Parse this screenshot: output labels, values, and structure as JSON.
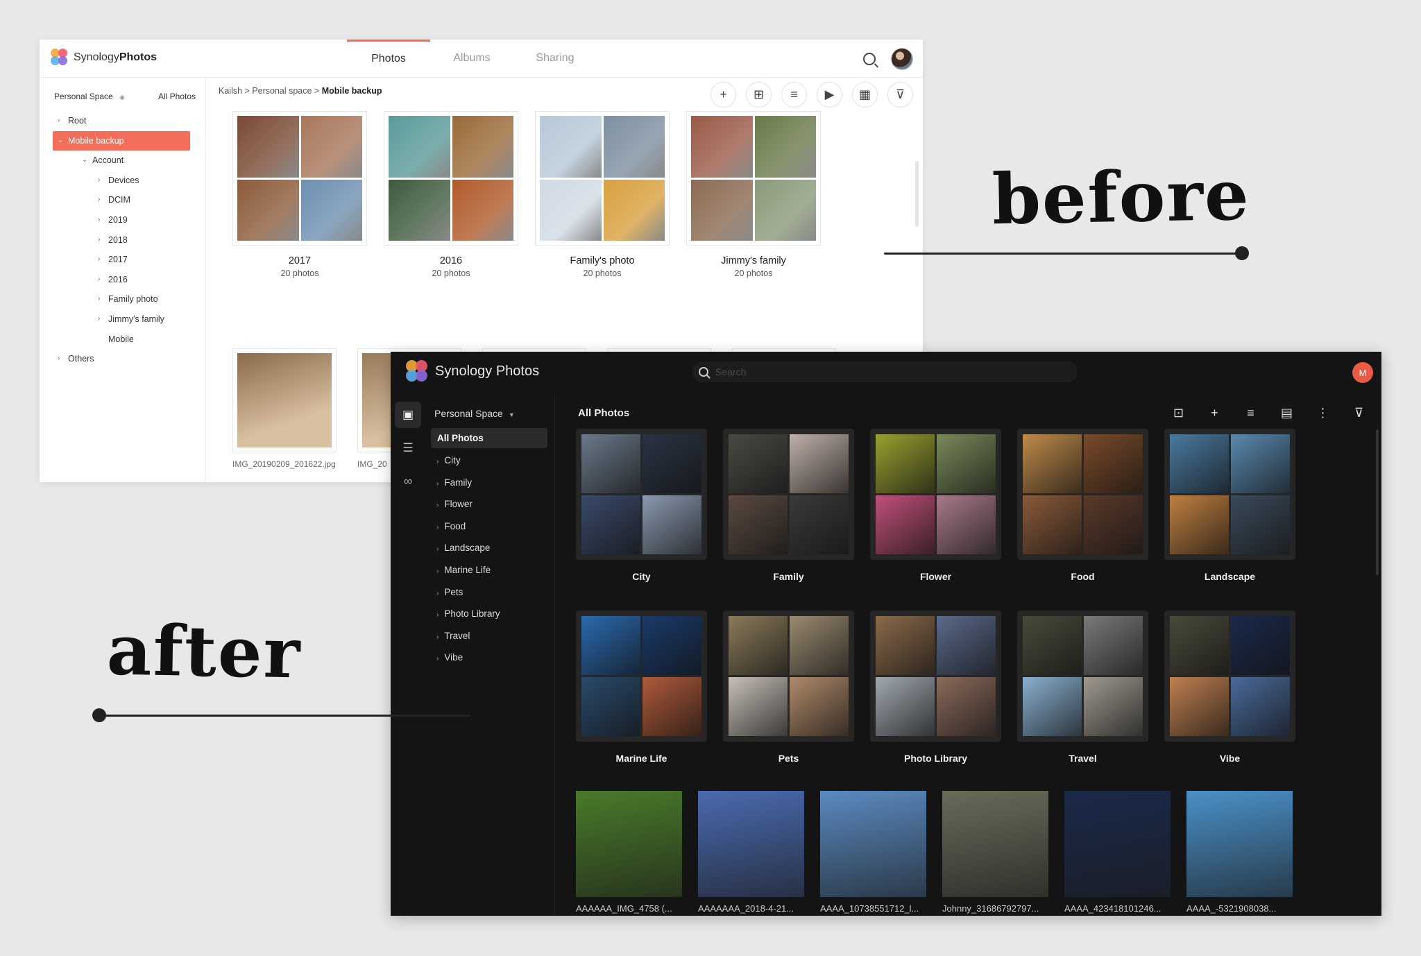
{
  "annotations": {
    "before": "before",
    "after": "after"
  },
  "colors": {
    "accent": "#f36e5a",
    "dark_bg": "#141414",
    "avatar": "#e85b47"
  },
  "light": {
    "brand_prefix": "Synology",
    "brand_suffix": "Photos",
    "tabs": [
      "Photos",
      "Albums",
      "Sharing"
    ],
    "active_tab": "Photos",
    "sidebar": {
      "space": "Personal Space",
      "all_photos": "All Photos",
      "tree": [
        {
          "label": "Root",
          "depth": 0,
          "icon": "chevron-right"
        },
        {
          "label": "Mobile backup",
          "depth": 0,
          "icon": "chevron-down",
          "selected": true
        },
        {
          "label": "Account",
          "depth": 1,
          "icon": "chevron-down"
        },
        {
          "label": "Devices",
          "depth": 2,
          "icon": "chevron-right"
        },
        {
          "label": "DCIM",
          "depth": 2,
          "icon": "chevron-right"
        },
        {
          "label": "2019",
          "depth": 2,
          "icon": "chevron-right"
        },
        {
          "label": "2018",
          "depth": 2,
          "icon": "chevron-right"
        },
        {
          "label": "2017",
          "depth": 2,
          "icon": "chevron-right"
        },
        {
          "label": "2016",
          "depth": 2,
          "icon": "chevron-right"
        },
        {
          "label": "Family photo",
          "depth": 2,
          "icon": "chevron-right"
        },
        {
          "label": "Jimmy's family",
          "depth": 2,
          "icon": "chevron-right"
        },
        {
          "label": "Mobile",
          "depth": 2,
          "icon": ""
        },
        {
          "label": "Others",
          "depth": 0,
          "icon": "chevron-right"
        }
      ]
    },
    "breadcrumb": {
      "path": "Kailsh > Personal space > ",
      "current": "Mobile backup"
    },
    "albums": [
      {
        "title": "2017",
        "count": "20 photos",
        "colors": [
          "#7a4a35",
          "#a8765a",
          "#8c5b3a",
          "#6d8fb0"
        ]
      },
      {
        "title": "2016",
        "count": "20 photos",
        "colors": [
          "#5b9a9a",
          "#9a6a3a",
          "#3e5a3e",
          "#b05a2a"
        ]
      },
      {
        "title": "Family's photo",
        "count": "20 photos",
        "colors": [
          "#b8c8d8",
          "#7d8fa0",
          "#d0dae4",
          "#d8a040"
        ]
      },
      {
        "title": "Jimmy's family",
        "count": "20 photos",
        "colors": [
          "#9a5a48",
          "#6a7a4a",
          "#8a6a52",
          "#8a9a7a"
        ]
      }
    ],
    "photos": [
      {
        "name": "IMG_20190209_201622.jpg",
        "color": "#8a6a4a"
      },
      {
        "name": "IMG_20",
        "color": "#9a7a5a"
      },
      {
        "name": "",
        "color": "#a88060"
      },
      {
        "name": "",
        "color": "#9a5a3a"
      },
      {
        "name": "",
        "color": "#a87a60"
      }
    ]
  },
  "dark": {
    "brand": "Synology Photos",
    "search_placeholder": "Search",
    "avatar_initial": "M",
    "space": "Personal Space",
    "tree": [
      "All Photos",
      "City",
      "Family",
      "Flower",
      "Food",
      "Landscape",
      "Marine Life",
      "Pets",
      "Photo Library",
      "Travel",
      "Vibe"
    ],
    "heading": "All Photos",
    "albums": [
      {
        "title": "City",
        "colors": [
          "#6a7a8a",
          "#2a3444",
          "#3a4a6a",
          "#8a9ab0"
        ]
      },
      {
        "title": "Family",
        "colors": [
          "#4a4a44",
          "#c0b0a8",
          "#5a4a40",
          "#3a3a3a"
        ]
      },
      {
        "title": "Flower",
        "colors": [
          "#9aa030",
          "#7a8a5a",
          "#c0507a",
          "#a87a8a"
        ]
      },
      {
        "title": "Food",
        "colors": [
          "#c08a4a",
          "#7a4a2a",
          "#8a5a3a",
          "#5a3a2a"
        ]
      },
      {
        "title": "Landscape",
        "colors": [
          "#4a7aa0",
          "#5a8ab0",
          "#c08040",
          "#3a4a5a"
        ]
      },
      {
        "title": "Marine Life",
        "colors": [
          "#2a6ab0",
          "#1a3a6a",
          "#2a4a6a",
          "#b05a3a"
        ]
      },
      {
        "title": "Pets",
        "colors": [
          "#8a7a5a",
          "#9a8a70",
          "#c8c0b8",
          "#b08a6a"
        ]
      },
      {
        "title": "Photo Library",
        "colors": [
          "#8a6a4a",
          "#5a6a8a",
          "#a0a8b0",
          "#8a6a5a"
        ]
      },
      {
        "title": "Travel",
        "colors": [
          "#4a4a3a",
          "#7a7a7a",
          "#8ab0d0",
          "#a09a90"
        ]
      },
      {
        "title": "Vibe",
        "colors": [
          "#4a4a3a",
          "#1a2a4a",
          "#c08050",
          "#4a6a9a"
        ]
      }
    ],
    "photos": [
      {
        "name": "AAAAAA_IMG_4758 (...",
        "color": "#4a7a2a"
      },
      {
        "name": "AAAAAAA_2018-4-21...",
        "color": "#4a6ab0"
      },
      {
        "name": "AAAA_10738551712_l...",
        "color": "#5a8ac0"
      },
      {
        "name": "Johnny_31686792797...",
        "color": "#6a6a5a"
      },
      {
        "name": "AAAA_423418101246...",
        "color": "#1a2a4a"
      },
      {
        "name": "AAAA_-5321908038...",
        "color": "#4a90c8"
      }
    ]
  }
}
